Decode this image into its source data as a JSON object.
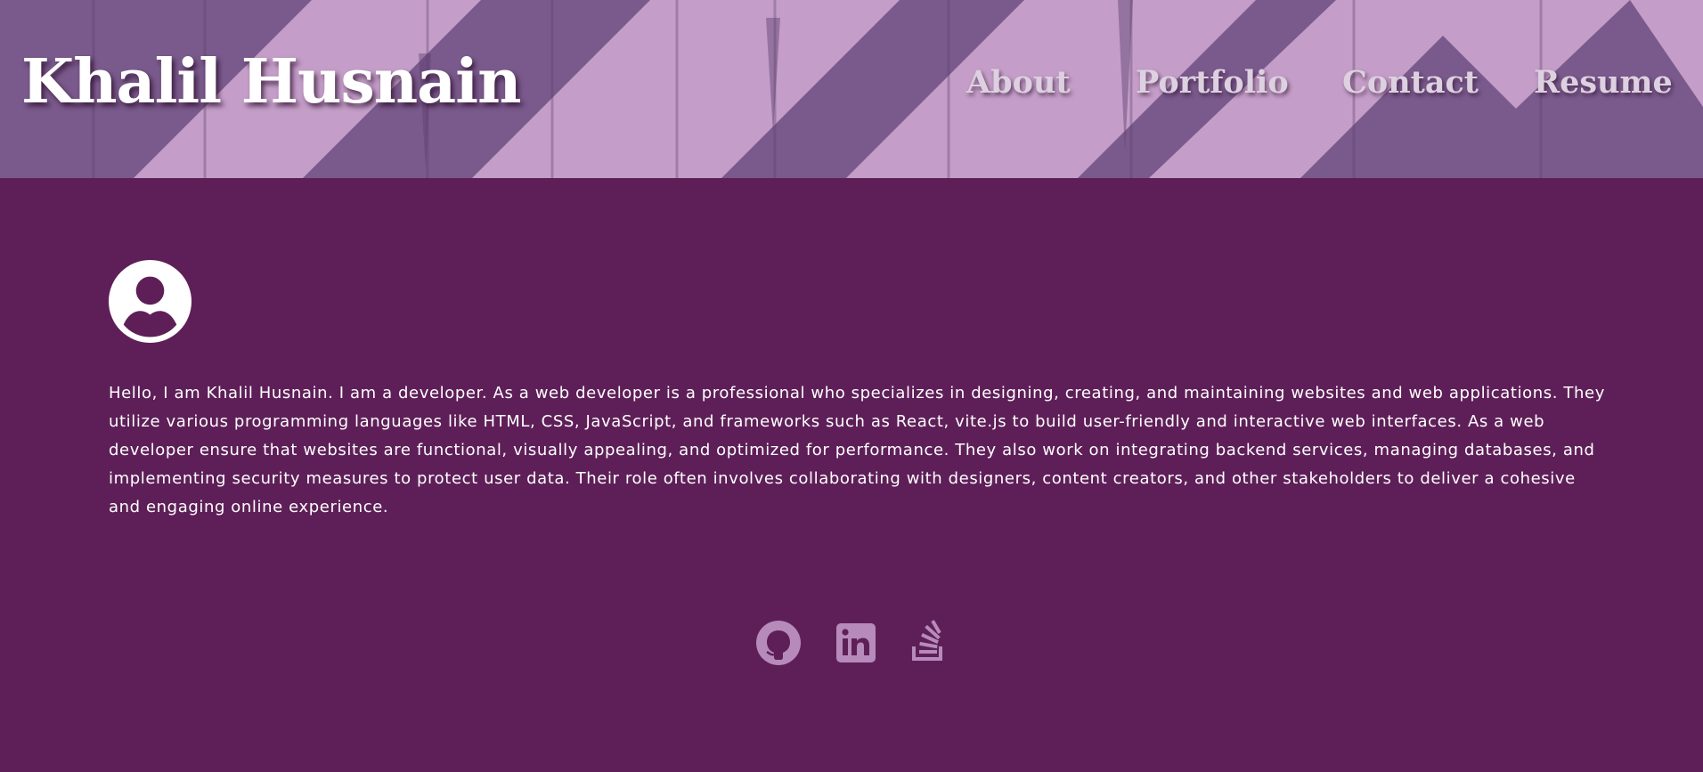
{
  "header": {
    "title": "Khalil Husnain",
    "nav": {
      "about": "About",
      "portfolio": "Portfolio",
      "contact": "Contact",
      "resume": "Resume"
    }
  },
  "profile": {
    "avatar_icon": "user-circle-icon",
    "bio": "Hello, I am Khalil Husnain. I am a developer. As a web developer is a professional who specializes in designing, creating, and maintaining websites and web applications. They utilize various programming languages like HTML, CSS, JavaScript, and frameworks such as React, vite.js to build user-friendly and interactive web interfaces. As a web developer ensure that websites are functional, visually appealing, and optimized for performance. They also work on integrating backend services, managing databases, and implementing security measures to protect user data. Their role often involves collaborating with designers, content creators, and other stakeholders to deliver a cohesive and engaging online experience."
  },
  "socials": [
    {
      "icon": "github-icon"
    },
    {
      "icon": "linkedin-icon"
    },
    {
      "icon": "stack-overflow-icon"
    }
  ],
  "colors": {
    "background": "#5e1f58",
    "header_dark": "#7a5a8c",
    "header_light": "#c49ec8",
    "text": "#ffffff",
    "nav_text": "#ddd0e0",
    "social_icon": "#b68bbb"
  }
}
